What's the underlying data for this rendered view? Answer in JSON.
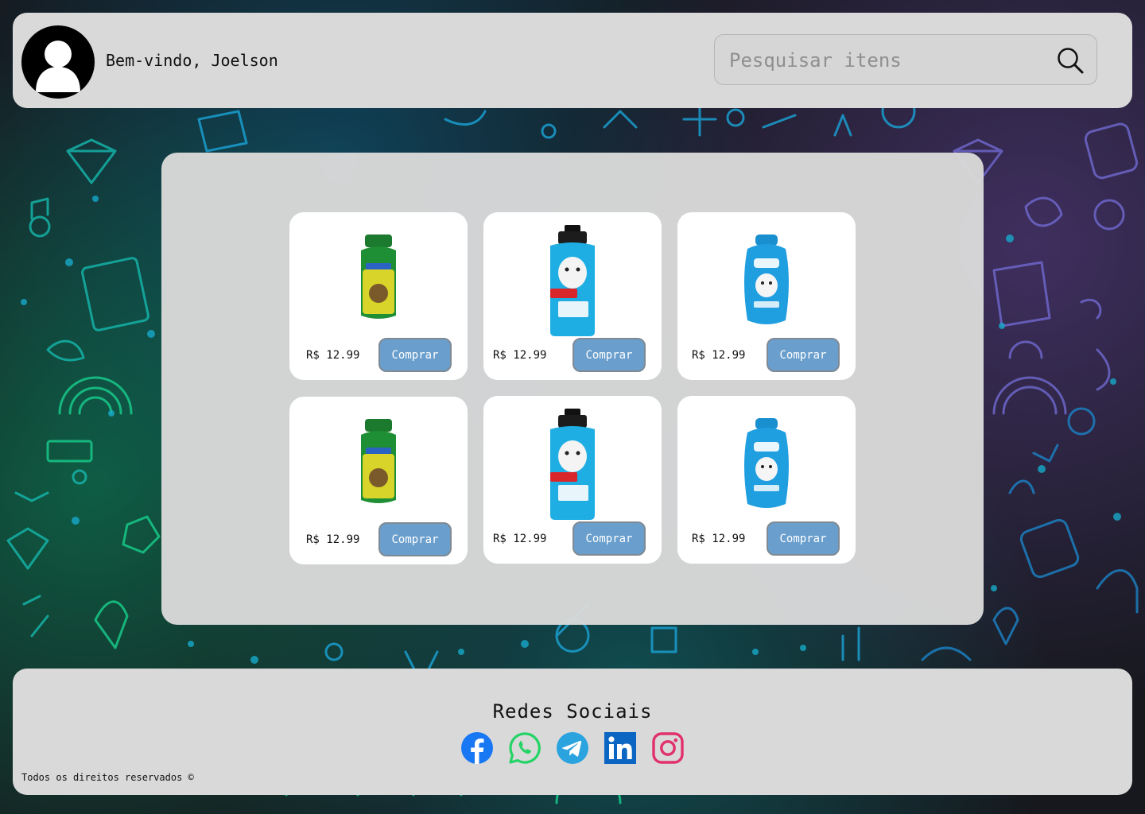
{
  "header": {
    "welcome_text": "Bem-vindo, Joelson",
    "search_placeholder": "Pesquisar itens"
  },
  "products": [
    {
      "price": "R$ 12.99",
      "button_label": "Comprar",
      "image": "green-shampoo-bottle"
    },
    {
      "price": "R$ 12.99",
      "button_label": "Comprar",
      "image": "sanol-dog-shampoo-bottle"
    },
    {
      "price": "R$ 12.99",
      "button_label": "Comprar",
      "image": "beeps-branqueador-bottle"
    },
    {
      "price": "R$ 12.99",
      "button_label": "Comprar",
      "image": "green-shampoo-bottle"
    },
    {
      "price": "R$ 12.99",
      "button_label": "Comprar",
      "image": "sanol-dog-shampoo-bottle"
    },
    {
      "price": "R$ 12.99",
      "button_label": "Comprar",
      "image": "beeps-branqueador-bottle"
    }
  ],
  "footer": {
    "title": "Redes Sociais",
    "social": [
      {
        "icon": "facebook-icon",
        "color": "#1877f2"
      },
      {
        "icon": "whatsapp-icon",
        "color": "#25d366"
      },
      {
        "icon": "telegram-icon",
        "color": "#2aa3df"
      },
      {
        "icon": "linkedin-icon",
        "color": "#0a66c2"
      },
      {
        "icon": "instagram-icon",
        "color": "#e1306c"
      }
    ],
    "copyright": "Todos os direitos reservados ©"
  },
  "colors": {
    "panel": "#d9d9d9",
    "button": "#6a9fcd",
    "background": "#16181d"
  }
}
